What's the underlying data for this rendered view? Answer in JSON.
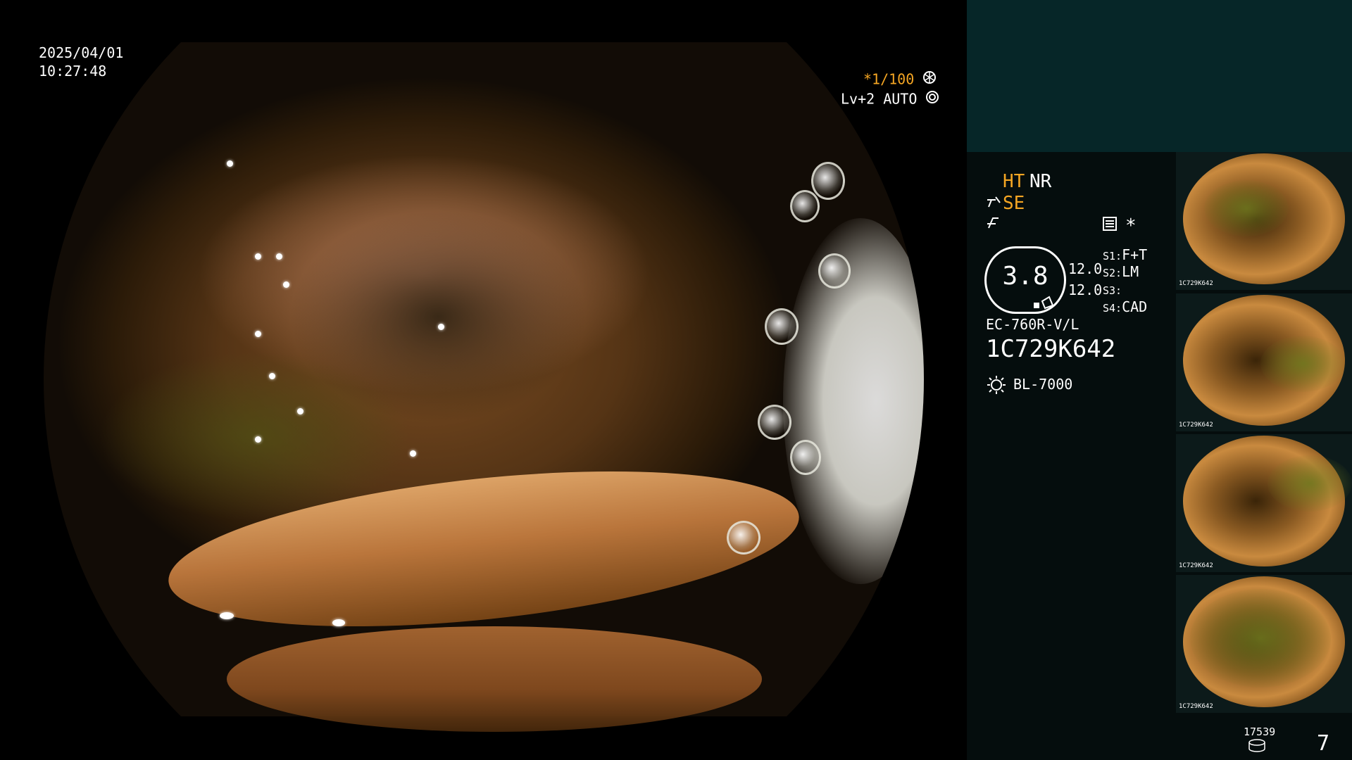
{
  "datetime": {
    "date": "2025/04/01",
    "time": "10:27:48"
  },
  "overlay": {
    "shutter": "*1/100",
    "shutter_icon": "aperture-icon",
    "level": "Lv+2",
    "mode": "AUTO",
    "mode_icon": "iris-icon"
  },
  "status": {
    "ht": "HT",
    "nr": "NR",
    "se": "SE",
    "zoom_value": "3.8",
    "val_a": "12.0",
    "val_b": "12.0",
    "s1_key": "S1:",
    "s1_val": "F+T",
    "s2_key": "S2:",
    "s2_val": "LM",
    "s3_key": "S3:",
    "s3_val": "",
    "s4_key": "S4:",
    "s4_val": "CAD",
    "scope_model": "EC-760R-V/L",
    "serial": "1C729K642",
    "light_source": "BL-7000",
    "asterisk": "*"
  },
  "thumbnails": [
    {
      "id": "1C729K642"
    },
    {
      "id": "1C729K642"
    },
    {
      "id": "1C729K642"
    },
    {
      "id": "1C729K642"
    }
  ],
  "footer": {
    "count": "17539",
    "page": "7"
  },
  "colors": {
    "accent": "#f5a623",
    "panel_top": "#062628",
    "panel": "#050d0d"
  }
}
